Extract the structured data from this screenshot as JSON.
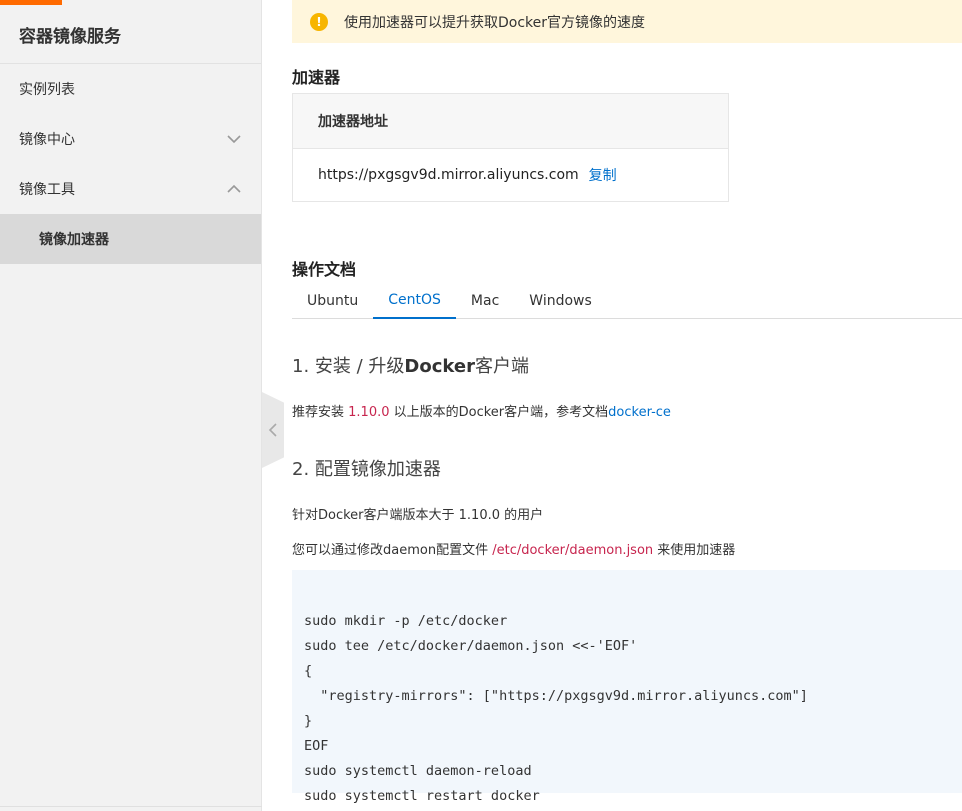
{
  "sidebar": {
    "title": "容器镜像服务",
    "items": [
      {
        "label": "实例列表"
      },
      {
        "label": "镜像中心"
      },
      {
        "label": "镜像工具"
      }
    ],
    "subitems": [
      {
        "label": "镜像加速器"
      }
    ]
  },
  "notice": {
    "icon": "warning-icon",
    "text": "使用加速器可以提升获取Docker官方镜像的速度"
  },
  "accelerator": {
    "title": "加速器",
    "header": "加速器地址",
    "address": "https://pxgsgv9d.mirror.aliyuncs.com",
    "copy_label": "复制"
  },
  "docs": {
    "title": "操作文档",
    "tabs": [
      "Ubuntu",
      "CentOS",
      "Mac",
      "Windows"
    ],
    "active_tab": "CentOS",
    "step1": {
      "num": "1. 安装 / 升级",
      "bold": "Docker",
      "rest": "客户端",
      "p_before": "推荐安装 ",
      "p_version": "1.10.0",
      "p_after": " 以上版本的Docker客户端，参考文档",
      "p_link": "docker-ce"
    },
    "step2": {
      "title": "2. 配置镜像加速器",
      "p1": "针对Docker客户端版本大于 1.10.0 的用户",
      "p2_before": "您可以通过修改daemon配置文件 ",
      "p2_path": "/etc/docker/daemon.json",
      "p2_after": " 来使用加速器"
    },
    "code_lines": [
      "sudo mkdir -p /etc/docker",
      "sudo tee /etc/docker/daemon.json <<-'EOF'",
      "{",
      "  \"registry-mirrors\": [\"https://pxgsgv9d.mirror.aliyuncs.com\"]",
      "}",
      "EOF",
      "sudo systemctl daemon-reload",
      "sudo systemctl restart docker"
    ]
  },
  "colors": {
    "accent": "#ff6a00",
    "link": "#0070cc",
    "highlight": "#c7254e",
    "notice_bg": "#fff6dc"
  }
}
